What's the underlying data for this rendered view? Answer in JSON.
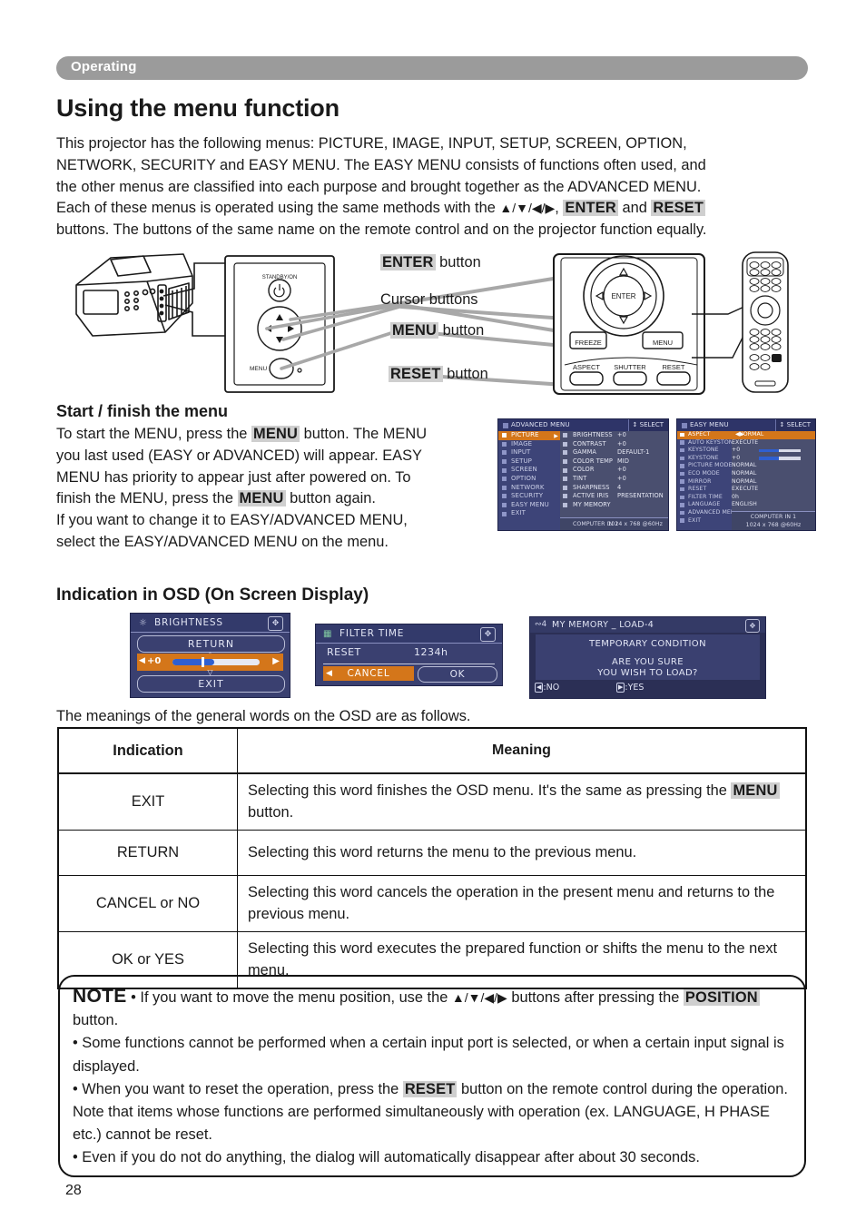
{
  "banner": {
    "label": "Operating"
  },
  "page_title": "Using the menu function",
  "intro": {
    "l1_a": "This projector has the following menus: PICTURE, IMAGE, INPUT, SETUP, SCREEN, OPTION,",
    "l2_a": "NETWORK, SECURITY and EASY MENU. The EASY MENU consists of functions often used, and",
    "l3_a": "the other menus are classified into each purpose and brought together as the ADVANCED MENU.",
    "l4_a": "Each of these menus is operated using the same methods with the ",
    "l4_arrows": "▲/▼/◀/▶",
    "l4_b": ", ",
    "l4_enter": "ENTER",
    "l4_c": " and ",
    "l4_reset": "RESET",
    "l5_a": "buttons. The buttons of the same name on the remote control and on the projector function equally."
  },
  "diagram": {
    "enter_label": "ENTER",
    "enter_suffix": " button",
    "cursor_label": "Cursor buttons",
    "menu_label": "MENU",
    "menu_suffix": " button",
    "reset_label": "RESET",
    "reset_suffix": " button",
    "projector_standby": "STANDBY/ON",
    "projector_menu": "MENU",
    "panel_enter": "ENTER",
    "panel_freeze": "FREEZE",
    "panel_menu": "MENU",
    "panel_aspect": "ASPECT",
    "panel_shutter": "SHUTTER",
    "panel_reset": "RESET"
  },
  "start_finish": {
    "heading": "Start / finish the menu",
    "p1_a": "To start the MENU, press the ",
    "p1_menu1": "MENU",
    "p1_b": " button. The MENU",
    "p2": "you last used (EASY or ADVANCED) will appear. EASY",
    "p3": "MENU has priority to appear just after powered on. To",
    "p4_a": "finish the MENU, press the ",
    "p4_menu2": "MENU",
    "p4_b": " button again.",
    "p5": "If you want to change it to EASY/ADVANCED MENU,",
    "p6": "select the EASY/ADVANCED MENU on the menu."
  },
  "advanced_menu": {
    "title": "ADVANCED MENU",
    "select": "↕ SELECT",
    "sidebar": [
      {
        "label": "PICTURE",
        "selected": true
      },
      {
        "label": "IMAGE",
        "selected": false
      },
      {
        "label": "INPUT",
        "selected": false
      },
      {
        "label": "SETUP",
        "selected": false
      },
      {
        "label": "SCREEN",
        "selected": false
      },
      {
        "label": "OPTION",
        "selected": false
      },
      {
        "label": "NETWORK",
        "selected": false
      },
      {
        "label": "SECURITY",
        "selected": false
      },
      {
        "label": "EASY MENU",
        "selected": false
      },
      {
        "label": "EXIT",
        "selected": false
      }
    ],
    "items": [
      {
        "label": "BRIGHTNESS",
        "value": "+0"
      },
      {
        "label": "CONTRAST",
        "value": "+0"
      },
      {
        "label": "GAMMA",
        "value": "DEFAULT-1"
      },
      {
        "label": "COLOR TEMP",
        "value": "MID"
      },
      {
        "label": "COLOR",
        "value": "+0"
      },
      {
        "label": "TINT",
        "value": "+0"
      },
      {
        "label": "SHARPNESS",
        "value": "4"
      },
      {
        "label": "ACTIVE IRIS",
        "value": "PRESENTATION"
      },
      {
        "label": "MY MEMORY",
        "value": ""
      }
    ],
    "footer_source": "COMPUTER IN 1",
    "footer_mode": "1024 x 768 @60Hz"
  },
  "easy_menu": {
    "title": "EASY MENU",
    "select": "↕ SELECT",
    "rows": [
      {
        "label": "ASPECT",
        "value": "NORMAL",
        "selected": true,
        "type": "option"
      },
      {
        "label": "AUTO KEYSTONE",
        "value": "EXECUTE",
        "selected": false,
        "type": "text"
      },
      {
        "label": "KEYSTONE",
        "value": "+0",
        "selected": false,
        "type": "slider"
      },
      {
        "label": "KEYSTONE",
        "value": "+0",
        "selected": false,
        "type": "slider"
      },
      {
        "label": "PICTURE MODE",
        "value": "NORMAL",
        "selected": false,
        "type": "text"
      },
      {
        "label": "ECO MODE",
        "value": "NORMAL",
        "selected": false,
        "type": "text"
      },
      {
        "label": "MIRROR",
        "value": "NORMAL",
        "selected": false,
        "type": "text"
      },
      {
        "label": "RESET",
        "value": "EXECUTE",
        "selected": false,
        "type": "text"
      },
      {
        "label": "FILTER TIME",
        "value": "0h",
        "selected": false,
        "type": "text"
      },
      {
        "label": "LANGUAGE",
        "value": "ENGLISH",
        "selected": false,
        "type": "text"
      },
      {
        "label": "ADVANCED MENU",
        "value": "",
        "selected": false,
        "type": "text"
      },
      {
        "label": "EXIT",
        "value": "",
        "selected": false,
        "type": "text"
      }
    ],
    "footer_source": "COMPUTER IN 1",
    "footer_mode": "1024 x 768 @60Hz"
  },
  "osd_section": {
    "heading": "Indication in OSD (On Screen Display)",
    "after_text": "The meanings of the general words on the OSD are as follows."
  },
  "dialog_brightness": {
    "title": "BRIGHTNESS",
    "return": "RETURN",
    "exit": "EXIT",
    "value": "+0"
  },
  "dialog_filter": {
    "title": "FILTER TIME",
    "reset_label": "RESET",
    "time_value": "1234h",
    "cancel": "CANCEL",
    "ok": "OK"
  },
  "dialog_memory": {
    "title": "MY MEMORY _ LOAD-4",
    "line1": "TEMPORARY CONDITION",
    "line2": "ARE YOU SURE",
    "line3": "YOU WISH TO LOAD?",
    "no": ":NO",
    "yes": ":YES"
  },
  "table": {
    "headers": [
      "Indication",
      "Meaning"
    ],
    "rows": [
      {
        "indication": "EXIT",
        "meaning_a": "Selecting this word finishes the OSD menu. It's the same as pressing the",
        "meaning_kbd": "MENU",
        "meaning_b": " button."
      },
      {
        "indication": "RETURN",
        "meaning_a": "Selecting this word returns the menu to the previous menu.",
        "meaning_kbd": "",
        "meaning_b": ""
      },
      {
        "indication": "CANCEL or NO",
        "meaning_a": "Selecting this word cancels the operation in the present menu and returns to the previous menu.",
        "meaning_kbd": "",
        "meaning_b": ""
      },
      {
        "indication": "OK or YES",
        "meaning_a": "Selecting this word executes the prepared function or shifts the menu to the next menu.",
        "meaning_kbd": "",
        "meaning_b": ""
      }
    ]
  },
  "note": {
    "label": "NOTE",
    "b1_a": " • If you want to move the menu position, use the ",
    "b1_arrows": "▲/▼/◀/▶",
    "b1_b": " buttons after pressing the ",
    "b1_kbd": "POSITION",
    "b1_c": " button.",
    "b2": "• Some functions cannot be performed when a certain input port is selected, or when a certain input signal is displayed.",
    "b3_a": "• When you want to reset the operation, press the ",
    "b3_kbd": "RESET",
    "b3_b": " button on the remote control during the operation. Note that items whose functions are performed simultaneously with operation (ex. LANGUAGE, H PHASE etc.) cannot be reset.",
    "b4": "• Even if you do not do anything, the dialog will automatically disappear after about 30 seconds."
  },
  "page_number": "28"
}
